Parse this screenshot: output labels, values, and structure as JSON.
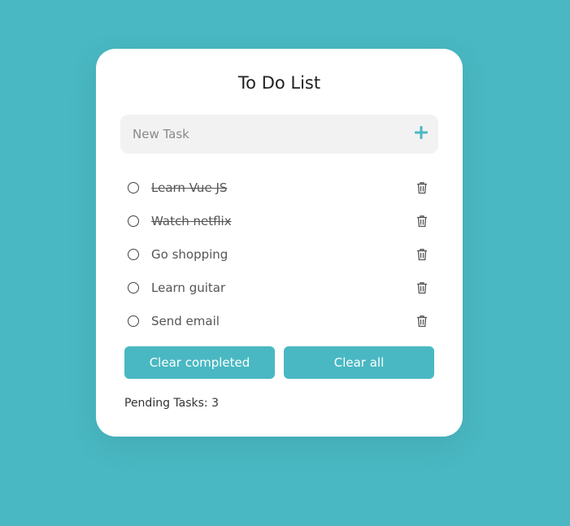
{
  "app": {
    "title": "To Do List"
  },
  "input": {
    "placeholder": "New Task",
    "add_icon": "plus-icon"
  },
  "tasks": [
    {
      "label": "Learn Vue JS",
      "completed": true
    },
    {
      "label": "Watch netflix",
      "completed": true
    },
    {
      "label": "Go shopping",
      "completed": false
    },
    {
      "label": "Learn guitar",
      "completed": false
    },
    {
      "label": "Send email",
      "completed": false
    }
  ],
  "actions": {
    "clear_completed_label": "Clear completed",
    "clear_all_label": "Clear all"
  },
  "footer": {
    "pending_label": "Pending Tasks: 3"
  },
  "colors": {
    "accent": "#49b8c2",
    "card": "#ffffff",
    "input_bg": "#f2f2f2"
  }
}
